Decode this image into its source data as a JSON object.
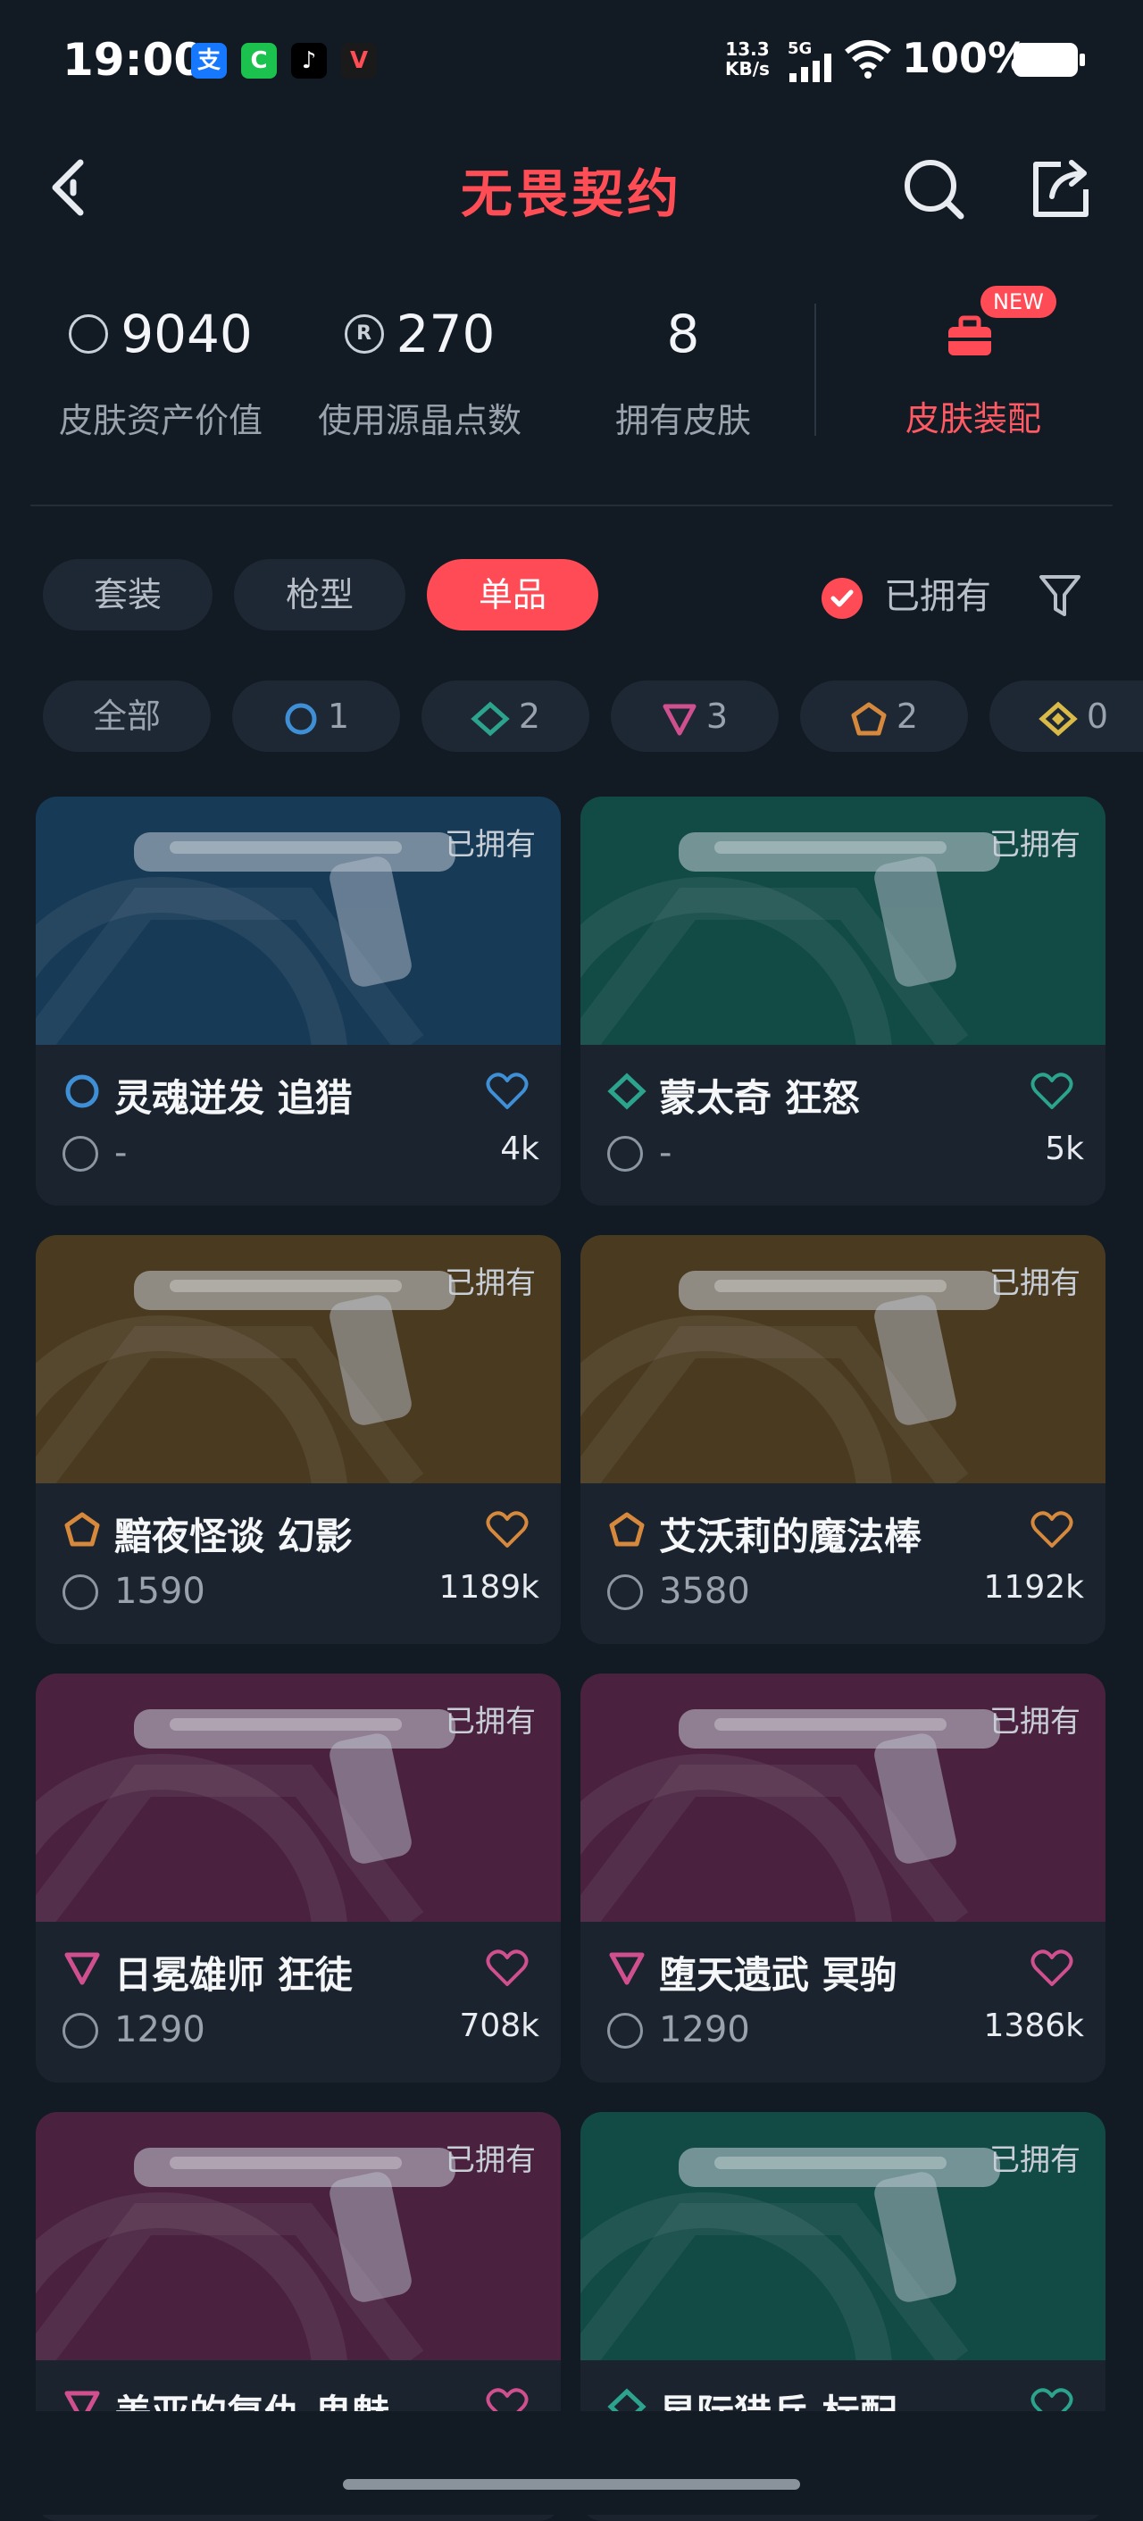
{
  "status_bar": {
    "time": "19:00",
    "net_speed_value": "13.3",
    "net_speed_unit": "KB/s",
    "network": "5G",
    "battery": "100%"
  },
  "header": {
    "title": "无畏契约"
  },
  "stats": [
    {
      "value": "9040",
      "label": "皮肤资产价值",
      "icon": "vp-coin-icon"
    },
    {
      "value": "270",
      "label": "使用源晶点数",
      "icon": "radianite-icon"
    },
    {
      "value": "8",
      "label": "拥有皮肤"
    }
  ],
  "loadout": {
    "badge": "NEW",
    "label": "皮肤装配"
  },
  "tabs": [
    {
      "label": "套装"
    },
    {
      "label": "枪型"
    },
    {
      "label": "单品",
      "active": true
    }
  ],
  "owned_filter": {
    "label": "已拥有",
    "checked": true
  },
  "tier_filters": [
    {
      "label": "全部"
    },
    {
      "count": "1",
      "tier": "select",
      "color": "#3f8fd6"
    },
    {
      "count": "2",
      "tier": "deluxe",
      "color": "#2ba38d"
    },
    {
      "count": "3",
      "tier": "premium",
      "color": "#d0508f"
    },
    {
      "count": "2",
      "tier": "exclusive",
      "color": "#d6893c"
    },
    {
      "count": "0",
      "tier": "ultra",
      "color": "#d9b948"
    }
  ],
  "owned_text": "已拥有",
  "skins": [
    {
      "name": "灵魂迸发 追猎",
      "price": "-",
      "likes": "4k",
      "tier_color": "#3f8fd6",
      "bg": "#173a56"
    },
    {
      "name": "蒙太奇 狂怒",
      "price": "-",
      "likes": "5k",
      "tier_color": "#2ba38d",
      "bg": "#124a46"
    },
    {
      "name": "黯夜怪谈 幻影",
      "price": "1590",
      "likes": "1189k",
      "tier_color": "#d6893c",
      "bg": "#4a3a20"
    },
    {
      "name": "艾沃莉的魔法棒",
      "price": "3580",
      "likes": "1192k",
      "tier_color": "#d6893c",
      "bg": "#4a3a20"
    },
    {
      "name": "日冕雄师 狂徒",
      "price": "1290",
      "likes": "708k",
      "tier_color": "#d0508f",
      "bg": "#4a2240"
    },
    {
      "name": "堕天遗武 冥驹",
      "price": "1290",
      "likes": "1386k",
      "tier_color": "#d0508f",
      "bg": "#4a2240"
    },
    {
      "name": "盖亚的复仇 鬼魅",
      "price": "",
      "likes": "",
      "tier_color": "#d0508f",
      "bg": "#4a2240"
    },
    {
      "name": "星际猎兵 标配",
      "price": "",
      "likes": "",
      "tier_color": "#2ba38d",
      "bg": "#124a46"
    }
  ]
}
